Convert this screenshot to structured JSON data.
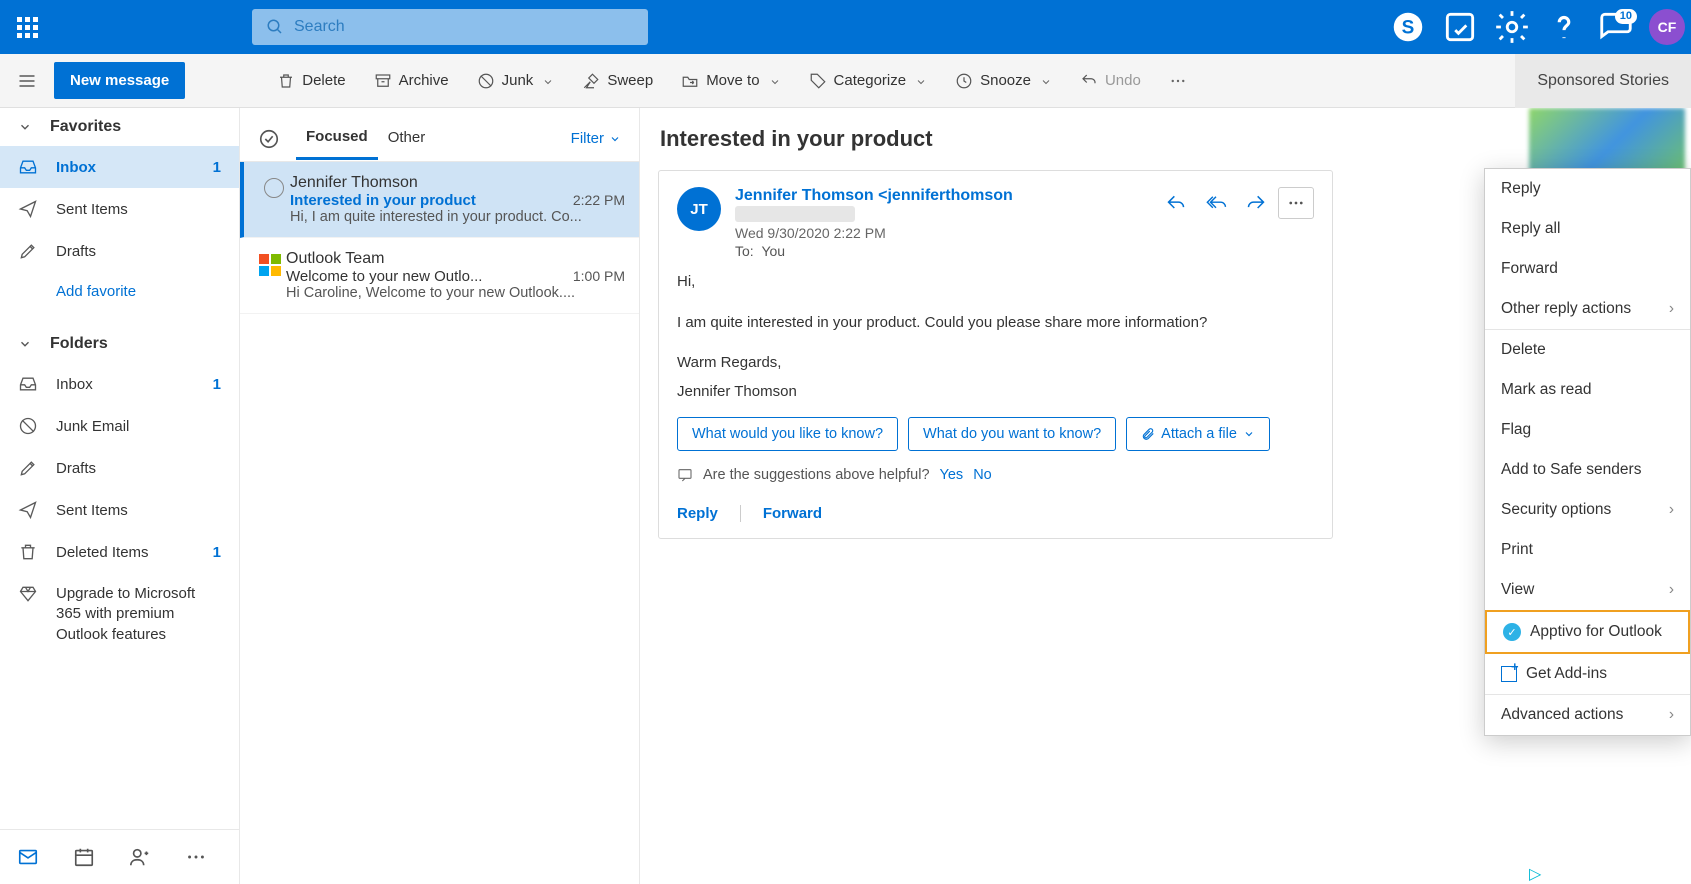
{
  "header": {
    "search_placeholder": "Search",
    "notification_count": "10",
    "avatar_initials": "CF"
  },
  "toolbar": {
    "new_message": "New message",
    "delete": "Delete",
    "archive": "Archive",
    "junk": "Junk",
    "sweep": "Sweep",
    "move_to": "Move to",
    "categorize": "Categorize",
    "snooze": "Snooze",
    "undo": "Undo",
    "sponsored": "Sponsored Stories"
  },
  "nav": {
    "favorites": "Favorites",
    "folders": "Folders",
    "fav_items": [
      {
        "icon": "inbox",
        "label": "Inbox",
        "count": "1",
        "active": true
      },
      {
        "icon": "sent",
        "label": "Sent Items"
      },
      {
        "icon": "drafts",
        "label": "Drafts"
      }
    ],
    "add_favorite": "Add favorite",
    "folder_items": [
      {
        "icon": "inbox",
        "label": "Inbox",
        "count": "1"
      },
      {
        "icon": "junk",
        "label": "Junk Email"
      },
      {
        "icon": "drafts",
        "label": "Drafts"
      },
      {
        "icon": "sent",
        "label": "Sent Items"
      },
      {
        "icon": "trash",
        "label": "Deleted Items",
        "count": "1"
      },
      {
        "icon": "diamond",
        "label": "Upgrade to Microsoft 365 with premium Outlook features"
      }
    ]
  },
  "list": {
    "tab_focused": "Focused",
    "tab_other": "Other",
    "filter": "Filter",
    "emails": [
      {
        "sender": "Jennifer Thomson",
        "subject": "Interested in your product",
        "time": "2:22 PM",
        "preview": "Hi, I am quite interested in your product. Co...",
        "unread": true,
        "icon": "circle"
      },
      {
        "sender": "Outlook Team",
        "subject": "Welcome to your new Outlo...",
        "time": "1:00 PM",
        "preview": "Hi Caroline, Welcome to your new Outlook....",
        "unread": false,
        "icon": "mslogo"
      }
    ]
  },
  "reader": {
    "title": "Interested in your product",
    "avatar": "JT",
    "from_name": "Jennifer Thomson",
    "from_email": "<jenniferthomson",
    "date": "Wed 9/30/2020 2:22 PM",
    "to_label": "To:",
    "to_value": "You",
    "body_greeting": "Hi,",
    "body_main": "I am quite interested in your product. Could you please share more information?",
    "body_regards": "Warm Regards,",
    "body_signature": "Jennifer Thomson",
    "suggestions": [
      "What would you like to know?",
      "What do you want to know?"
    ],
    "attach_file": "Attach a file",
    "feedback_q": "Are the suggestions above helpful?",
    "feedback_yes": "Yes",
    "feedback_no": "No",
    "reply": "Reply",
    "forward": "Forward"
  },
  "context_menu": {
    "items": [
      {
        "label": "Reply"
      },
      {
        "label": "Reply all"
      },
      {
        "label": "Forward"
      },
      {
        "label": "Other reply actions",
        "chevron": true
      },
      {
        "sep": true
      },
      {
        "label": "Delete"
      },
      {
        "label": "Mark as read"
      },
      {
        "label": "Flag"
      },
      {
        "label": "Add to Safe senders"
      },
      {
        "label": "Security options",
        "chevron": true
      },
      {
        "label": "Print"
      },
      {
        "label": "View",
        "chevron": true
      },
      {
        "label": "Apptivo for Outlook",
        "icon": "apptivo",
        "highlight": true
      },
      {
        "label": "Get Add-ins",
        "icon": "addins"
      },
      {
        "sep": true
      },
      {
        "label": "Advanced actions",
        "chevron": true
      }
    ]
  }
}
